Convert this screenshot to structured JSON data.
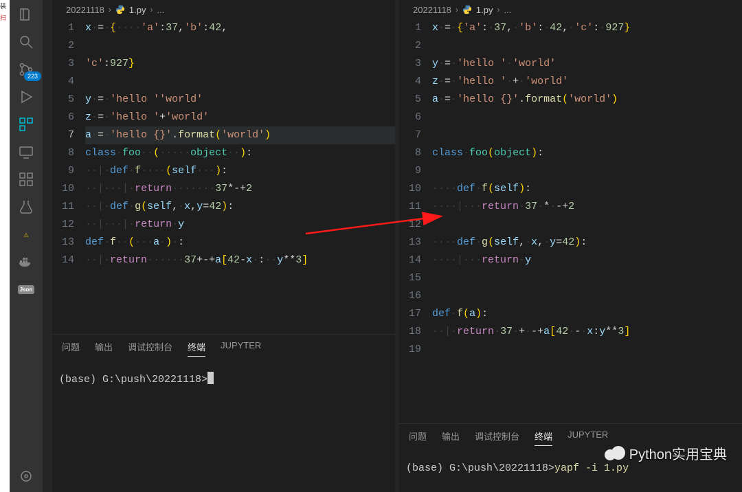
{
  "activity_bar": {
    "badge": "223",
    "json_label": "Json"
  },
  "breadcrumbs": {
    "folder": "20221118",
    "file": "1.py",
    "ellipsis": "..."
  },
  "editor_left": {
    "active_line": 7,
    "lines": [
      [
        {
          "c": "tok-var",
          "t": "x"
        },
        {
          "c": "ws",
          "t": "·"
        },
        {
          "c": "tok-op",
          "t": "="
        },
        {
          "c": "ws",
          "t": "·"
        },
        {
          "c": "tok-brace",
          "t": "{"
        },
        {
          "c": "ws",
          "t": "····"
        },
        {
          "c": "tok-str",
          "t": "'a'"
        },
        {
          "c": "tok-punc",
          "t": ":"
        },
        {
          "c": "tok-num",
          "t": "37"
        },
        {
          "c": "tok-punc",
          "t": ","
        },
        {
          "c": "tok-str",
          "t": "'b'"
        },
        {
          "c": "tok-punc",
          "t": ":"
        },
        {
          "c": "tok-num",
          "t": "42"
        },
        {
          "c": "tok-punc",
          "t": ","
        }
      ],
      [],
      [
        {
          "c": "tok-str",
          "t": "'c'"
        },
        {
          "c": "tok-punc",
          "t": ":"
        },
        {
          "c": "tok-num",
          "t": "927"
        },
        {
          "c": "tok-brace",
          "t": "}"
        }
      ],
      [],
      [
        {
          "c": "tok-var",
          "t": "y"
        },
        {
          "c": "ws",
          "t": "·"
        },
        {
          "c": "tok-op",
          "t": "="
        },
        {
          "c": "ws",
          "t": "·"
        },
        {
          "c": "tok-str",
          "t": "'hello '"
        },
        {
          "c": "tok-str",
          "t": "'world'"
        }
      ],
      [
        {
          "c": "tok-var",
          "t": "z"
        },
        {
          "c": "ws",
          "t": "·"
        },
        {
          "c": "tok-op",
          "t": "="
        },
        {
          "c": "ws",
          "t": "·"
        },
        {
          "c": "tok-str",
          "t": "'hello '"
        },
        {
          "c": "tok-op",
          "t": "+"
        },
        {
          "c": "tok-str",
          "t": "'world'"
        }
      ],
      [
        {
          "c": "tok-var",
          "t": "a"
        },
        {
          "c": "ws",
          "t": "·"
        },
        {
          "c": "tok-op",
          "t": "="
        },
        {
          "c": "ws",
          "t": "·"
        },
        {
          "c": "tok-str",
          "t": "'hello {}'"
        },
        {
          "c": "tok-punc",
          "t": "."
        },
        {
          "c": "tok-fn",
          "t": "format"
        },
        {
          "c": "tok-brace",
          "t": "("
        },
        {
          "c": "tok-str",
          "t": "'world'"
        },
        {
          "c": "tok-brace",
          "t": ")"
        }
      ],
      [
        {
          "c": "tok-key",
          "t": "class"
        },
        {
          "c": "ws",
          "t": "·"
        },
        {
          "c": "tok-cls",
          "t": "foo"
        },
        {
          "c": "ws",
          "t": "··"
        },
        {
          "c": "tok-brace",
          "t": "("
        },
        {
          "c": "ws",
          "t": "·····"
        },
        {
          "c": "tok-cls",
          "t": "object"
        },
        {
          "c": "ws",
          "t": "··"
        },
        {
          "c": "tok-brace",
          "t": ")"
        },
        {
          "c": "tok-punc",
          "t": ":"
        }
      ],
      [
        {
          "c": "ws",
          "t": "··"
        },
        {
          "c": "indent-guide",
          "t": "|"
        },
        {
          "c": "ws",
          "t": "·"
        },
        {
          "c": "tok-key",
          "t": "def"
        },
        {
          "c": "ws",
          "t": "·"
        },
        {
          "c": "tok-fn",
          "t": "f"
        },
        {
          "c": "ws",
          "t": "····"
        },
        {
          "c": "tok-brace",
          "t": "("
        },
        {
          "c": "tok-param",
          "t": "self"
        },
        {
          "c": "ws",
          "t": "···"
        },
        {
          "c": "tok-brace",
          "t": ")"
        },
        {
          "c": "tok-punc",
          "t": ":"
        }
      ],
      [
        {
          "c": "ws",
          "t": "··"
        },
        {
          "c": "indent-guide",
          "t": "|"
        },
        {
          "c": "ws",
          "t": "···"
        },
        {
          "c": "indent-guide",
          "t": "|"
        },
        {
          "c": "ws",
          "t": "·"
        },
        {
          "c": "tok-key2",
          "t": "return"
        },
        {
          "c": "ws",
          "t": "·······"
        },
        {
          "c": "tok-num",
          "t": "37"
        },
        {
          "c": "tok-op",
          "t": "*"
        },
        {
          "c": "tok-op",
          "t": "-+"
        },
        {
          "c": "tok-num",
          "t": "2"
        }
      ],
      [
        {
          "c": "ws",
          "t": "··"
        },
        {
          "c": "indent-guide",
          "t": "|"
        },
        {
          "c": "ws",
          "t": "·"
        },
        {
          "c": "tok-key",
          "t": "def"
        },
        {
          "c": "ws",
          "t": "·"
        },
        {
          "c": "tok-fn",
          "t": "g"
        },
        {
          "c": "tok-brace",
          "t": "("
        },
        {
          "c": "tok-param",
          "t": "self"
        },
        {
          "c": "tok-punc",
          "t": ","
        },
        {
          "c": "ws",
          "t": "·"
        },
        {
          "c": "tok-param",
          "t": "x"
        },
        {
          "c": "tok-punc",
          "t": ","
        },
        {
          "c": "tok-param",
          "t": "y"
        },
        {
          "c": "tok-op",
          "t": "="
        },
        {
          "c": "tok-num",
          "t": "42"
        },
        {
          "c": "tok-brace",
          "t": ")"
        },
        {
          "c": "tok-punc",
          "t": ":"
        }
      ],
      [
        {
          "c": "ws",
          "t": "··"
        },
        {
          "c": "indent-guide",
          "t": "|"
        },
        {
          "c": "ws",
          "t": "···"
        },
        {
          "c": "indent-guide",
          "t": "|"
        },
        {
          "c": "ws",
          "t": "·"
        },
        {
          "c": "tok-key2",
          "t": "return"
        },
        {
          "c": "ws",
          "t": "·"
        },
        {
          "c": "tok-var",
          "t": "y"
        }
      ],
      [
        {
          "c": "tok-key",
          "t": "def"
        },
        {
          "c": "ws",
          "t": "·"
        },
        {
          "c": "tok-fn",
          "t": "f"
        },
        {
          "c": "ws",
          "t": "··"
        },
        {
          "c": "tok-brace",
          "t": "("
        },
        {
          "c": "ws",
          "t": "···"
        },
        {
          "c": "tok-param",
          "t": "a"
        },
        {
          "c": "ws",
          "t": "·"
        },
        {
          "c": "tok-brace",
          "t": ")"
        },
        {
          "c": "ws",
          "t": "·"
        },
        {
          "c": "tok-punc",
          "t": ":"
        }
      ],
      [
        {
          "c": "ws",
          "t": "··"
        },
        {
          "c": "indent-guide",
          "t": "|"
        },
        {
          "c": "ws",
          "t": "·"
        },
        {
          "c": "tok-key2",
          "t": "return"
        },
        {
          "c": "ws",
          "t": "······"
        },
        {
          "c": "tok-num",
          "t": "37"
        },
        {
          "c": "tok-op",
          "t": "+-+"
        },
        {
          "c": "tok-var",
          "t": "a"
        },
        {
          "c": "tok-brace",
          "t": "["
        },
        {
          "c": "tok-num",
          "t": "42"
        },
        {
          "c": "tok-op",
          "t": "-"
        },
        {
          "c": "tok-var",
          "t": "x"
        },
        {
          "c": "ws",
          "t": "·"
        },
        {
          "c": "tok-punc",
          "t": ":"
        },
        {
          "c": "ws",
          "t": "··"
        },
        {
          "c": "tok-var",
          "t": "y"
        },
        {
          "c": "tok-op",
          "t": "**"
        },
        {
          "c": "tok-num",
          "t": "3"
        },
        {
          "c": "tok-brace",
          "t": "]"
        }
      ]
    ]
  },
  "editor_right": {
    "active_line": 0,
    "lines": [
      [
        {
          "c": "tok-var",
          "t": "x"
        },
        {
          "c": "ws",
          "t": "·"
        },
        {
          "c": "tok-op",
          "t": "="
        },
        {
          "c": "ws",
          "t": "·"
        },
        {
          "c": "tok-brace",
          "t": "{"
        },
        {
          "c": "tok-str",
          "t": "'a'"
        },
        {
          "c": "tok-punc",
          "t": ":"
        },
        {
          "c": "ws",
          "t": "·"
        },
        {
          "c": "tok-num",
          "t": "37"
        },
        {
          "c": "tok-punc",
          "t": ","
        },
        {
          "c": "ws",
          "t": "·"
        },
        {
          "c": "tok-str",
          "t": "'b'"
        },
        {
          "c": "tok-punc",
          "t": ":"
        },
        {
          "c": "ws",
          "t": "·"
        },
        {
          "c": "tok-num",
          "t": "42"
        },
        {
          "c": "tok-punc",
          "t": ","
        },
        {
          "c": "ws",
          "t": "·"
        },
        {
          "c": "tok-str",
          "t": "'c'"
        },
        {
          "c": "tok-punc",
          "t": ":"
        },
        {
          "c": "ws",
          "t": "·"
        },
        {
          "c": "tok-num",
          "t": "927"
        },
        {
          "c": "tok-brace",
          "t": "}"
        }
      ],
      [],
      [
        {
          "c": "tok-var",
          "t": "y"
        },
        {
          "c": "ws",
          "t": "·"
        },
        {
          "c": "tok-op",
          "t": "="
        },
        {
          "c": "ws",
          "t": "·"
        },
        {
          "c": "tok-str",
          "t": "'hello '"
        },
        {
          "c": "ws",
          "t": "·"
        },
        {
          "c": "tok-str",
          "t": "'world'"
        }
      ],
      [
        {
          "c": "tok-var",
          "t": "z"
        },
        {
          "c": "ws",
          "t": "·"
        },
        {
          "c": "tok-op",
          "t": "="
        },
        {
          "c": "ws",
          "t": "·"
        },
        {
          "c": "tok-str",
          "t": "'hello '"
        },
        {
          "c": "ws",
          "t": "·"
        },
        {
          "c": "tok-op",
          "t": "+"
        },
        {
          "c": "ws",
          "t": "·"
        },
        {
          "c": "tok-str",
          "t": "'world'"
        }
      ],
      [
        {
          "c": "tok-var",
          "t": "a"
        },
        {
          "c": "ws",
          "t": "·"
        },
        {
          "c": "tok-op",
          "t": "="
        },
        {
          "c": "ws",
          "t": "·"
        },
        {
          "c": "tok-str",
          "t": "'hello {}'"
        },
        {
          "c": "tok-punc",
          "t": "."
        },
        {
          "c": "tok-fn",
          "t": "format"
        },
        {
          "c": "tok-brace",
          "t": "("
        },
        {
          "c": "tok-str",
          "t": "'world'"
        },
        {
          "c": "tok-brace",
          "t": ")"
        }
      ],
      [],
      [],
      [
        {
          "c": "tok-key",
          "t": "class"
        },
        {
          "c": "ws",
          "t": "·"
        },
        {
          "c": "tok-cls",
          "t": "foo"
        },
        {
          "c": "tok-brace",
          "t": "("
        },
        {
          "c": "tok-cls",
          "t": "object"
        },
        {
          "c": "tok-brace",
          "t": ")"
        },
        {
          "c": "tok-punc",
          "t": ":"
        }
      ],
      [],
      [
        {
          "c": "ws",
          "t": "····"
        },
        {
          "c": "tok-key",
          "t": "def"
        },
        {
          "c": "ws",
          "t": "·"
        },
        {
          "c": "tok-fn",
          "t": "f"
        },
        {
          "c": "tok-brace",
          "t": "("
        },
        {
          "c": "tok-param",
          "t": "self"
        },
        {
          "c": "tok-brace",
          "t": ")"
        },
        {
          "c": "tok-punc",
          "t": ":"
        }
      ],
      [
        {
          "c": "ws",
          "t": "····"
        },
        {
          "c": "indent-guide",
          "t": "|"
        },
        {
          "c": "ws",
          "t": "···"
        },
        {
          "c": "tok-key2",
          "t": "return"
        },
        {
          "c": "ws",
          "t": "·"
        },
        {
          "c": "tok-num",
          "t": "37"
        },
        {
          "c": "ws",
          "t": "·"
        },
        {
          "c": "tok-op",
          "t": "*"
        },
        {
          "c": "ws",
          "t": "·"
        },
        {
          "c": "tok-op",
          "t": "-+"
        },
        {
          "c": "tok-num",
          "t": "2"
        }
      ],
      [],
      [
        {
          "c": "ws",
          "t": "····"
        },
        {
          "c": "tok-key",
          "t": "def"
        },
        {
          "c": "ws",
          "t": "·"
        },
        {
          "c": "tok-fn",
          "t": "g"
        },
        {
          "c": "tok-brace",
          "t": "("
        },
        {
          "c": "tok-param",
          "t": "self"
        },
        {
          "c": "tok-punc",
          "t": ","
        },
        {
          "c": "ws",
          "t": "·"
        },
        {
          "c": "tok-param",
          "t": "x"
        },
        {
          "c": "tok-punc",
          "t": ","
        },
        {
          "c": "ws",
          "t": "·"
        },
        {
          "c": "tok-param",
          "t": "y"
        },
        {
          "c": "tok-op",
          "t": "="
        },
        {
          "c": "tok-num",
          "t": "42"
        },
        {
          "c": "tok-brace",
          "t": ")"
        },
        {
          "c": "tok-punc",
          "t": ":"
        }
      ],
      [
        {
          "c": "ws",
          "t": "····"
        },
        {
          "c": "indent-guide",
          "t": "|"
        },
        {
          "c": "ws",
          "t": "···"
        },
        {
          "c": "tok-key2",
          "t": "return"
        },
        {
          "c": "ws",
          "t": "·"
        },
        {
          "c": "tok-var",
          "t": "y"
        }
      ],
      [],
      [],
      [
        {
          "c": "tok-key",
          "t": "def"
        },
        {
          "c": "ws",
          "t": "·"
        },
        {
          "c": "tok-fn",
          "t": "f"
        },
        {
          "c": "tok-brace",
          "t": "("
        },
        {
          "c": "tok-param",
          "t": "a"
        },
        {
          "c": "tok-brace",
          "t": ")"
        },
        {
          "c": "tok-punc",
          "t": ":"
        }
      ],
      [
        {
          "c": "ws",
          "t": "··"
        },
        {
          "c": "indent-guide",
          "t": "|"
        },
        {
          "c": "ws",
          "t": "·"
        },
        {
          "c": "tok-key2",
          "t": "return"
        },
        {
          "c": "ws",
          "t": "·"
        },
        {
          "c": "tok-num",
          "t": "37"
        },
        {
          "c": "ws",
          "t": "·"
        },
        {
          "c": "tok-op",
          "t": "+"
        },
        {
          "c": "ws",
          "t": "·"
        },
        {
          "c": "tok-op",
          "t": "-+"
        },
        {
          "c": "tok-var",
          "t": "a"
        },
        {
          "c": "tok-brace",
          "t": "["
        },
        {
          "c": "tok-num",
          "t": "42"
        },
        {
          "c": "ws",
          "t": "·"
        },
        {
          "c": "tok-op",
          "t": "-"
        },
        {
          "c": "ws",
          "t": "·"
        },
        {
          "c": "tok-var",
          "t": "x"
        },
        {
          "c": "tok-punc",
          "t": ":"
        },
        {
          "c": "tok-var",
          "t": "y"
        },
        {
          "c": "tok-op",
          "t": "**"
        },
        {
          "c": "tok-num",
          "t": "3"
        },
        {
          "c": "tok-brace",
          "t": "]"
        }
      ],
      []
    ]
  },
  "panel": {
    "tabs": [
      "问题",
      "输出",
      "调试控制台",
      "终端",
      "JUPYTER"
    ],
    "active": 3
  },
  "terminal_left": {
    "prompt": "(base) G:\\push\\20221118>"
  },
  "terminal_right": {
    "prompt": "(base) G:\\push\\20221118>",
    "command": "yapf -i 1.py"
  },
  "watermark": "Python实用宝典"
}
